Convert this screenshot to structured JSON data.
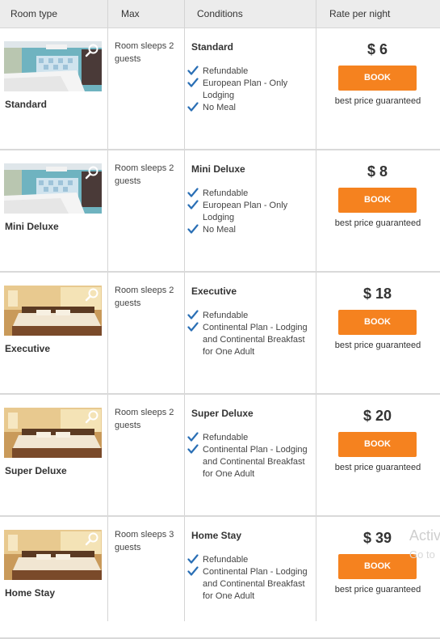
{
  "header": {
    "room_type": "Room type",
    "max": "Max",
    "conditions": "Conditions",
    "rate": "Rate per night"
  },
  "rooms": [
    {
      "name": "Standard",
      "image": "room-photo-blue-walls",
      "sleeps": "Room sleeps 2 guests",
      "condition_title": "Standard",
      "conditions": [
        "Refundable",
        "European Plan - Only Lodging",
        "No Meal"
      ],
      "price": "$ 6",
      "book": "BOOK",
      "guarantee": "best price guaranteed"
    },
    {
      "name": "Mini Deluxe",
      "image": "room-photo-blue-walls",
      "sleeps": "Room sleeps 2 guests",
      "condition_title": "Mini Deluxe",
      "conditions": [
        "Refundable",
        "European Plan - Only Lodging",
        "No Meal"
      ],
      "price": "$ 8",
      "book": "BOOK",
      "guarantee": "best price guaranteed"
    },
    {
      "name": "Executive",
      "image": "room-photo-warm-bedroom",
      "sleeps": "Room sleeps 2 guests",
      "condition_title": "Executive",
      "conditions": [
        "Refundable",
        "Continental Plan - Lodging and Continental Breakfast for One Adult"
      ],
      "price": "$ 18",
      "book": "BOOK",
      "guarantee": "best price guaranteed"
    },
    {
      "name": "Super Deluxe",
      "image": "room-photo-warm-bedroom",
      "sleeps": "Room sleeps 2 guests",
      "condition_title": "Super Deluxe",
      "conditions": [
        "Refundable",
        "Continental Plan - Lodging and Continental Breakfast for One Adult"
      ],
      "price": "$ 20",
      "book": "BOOK",
      "guarantee": "best price guaranteed"
    },
    {
      "name": "Home Stay",
      "image": "room-photo-warm-bedroom",
      "sleeps": "Room sleeps 3 guests",
      "condition_title": "Home Stay",
      "conditions": [
        "Refundable",
        "Continental Plan - Lodging and Continental Breakfast for One Adult"
      ],
      "price": "$ 39",
      "book": "BOOK",
      "guarantee": "best price guaranteed"
    }
  ],
  "watermark": {
    "line1": "Activ",
    "line2": "Go to"
  },
  "colors": {
    "book_button": "#f5821f",
    "check_icon": "#2a6fb5",
    "header_bg": "#ececec"
  },
  "icons": {
    "zoom": "magnifier-icon",
    "check": "check-icon"
  }
}
